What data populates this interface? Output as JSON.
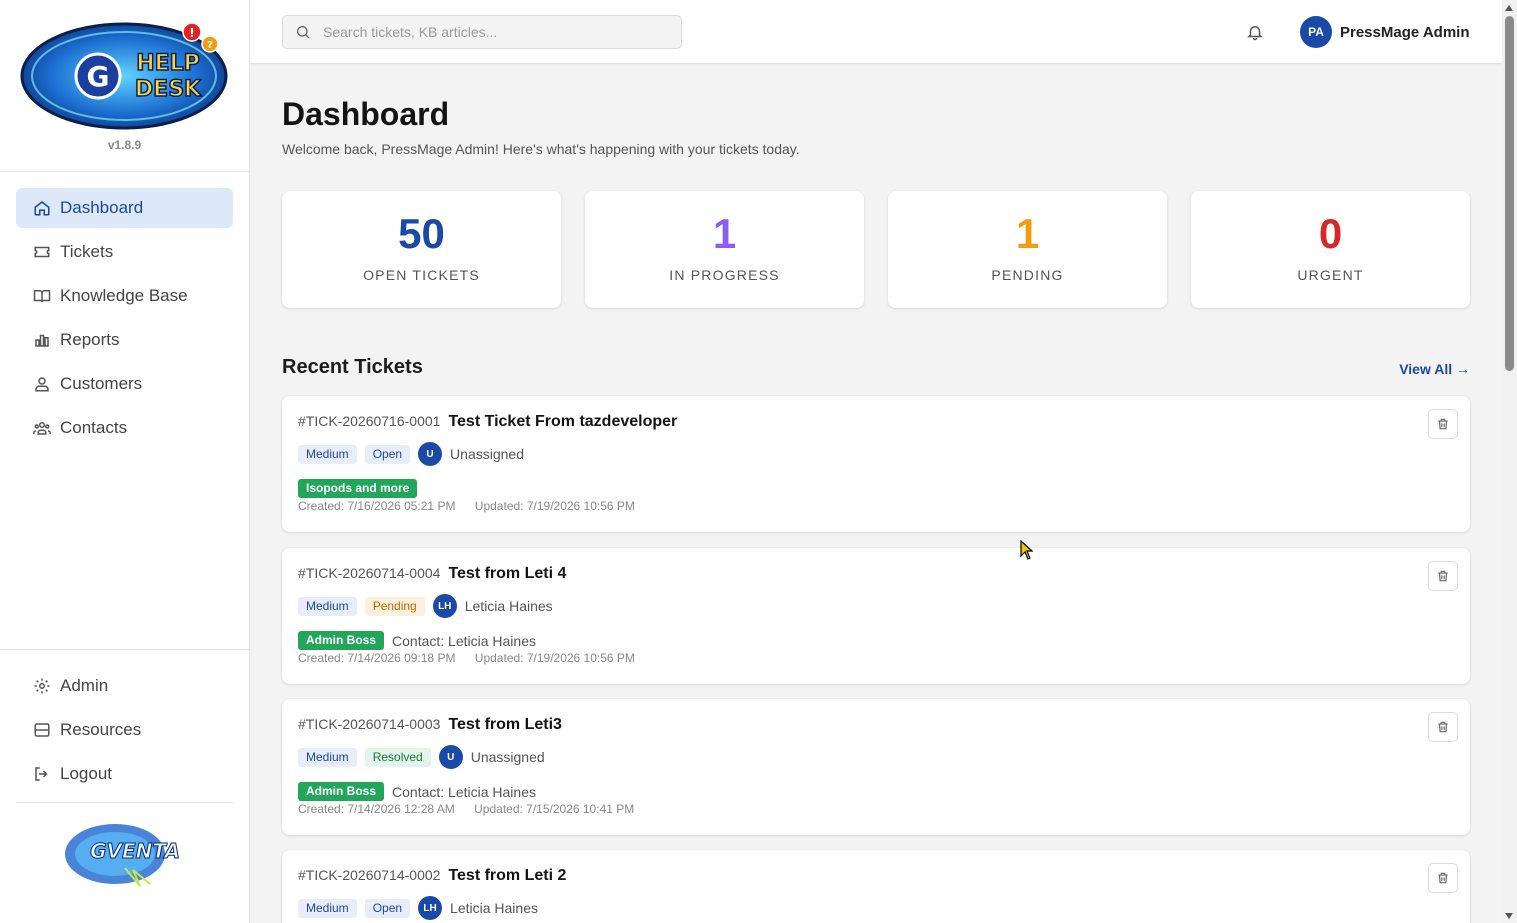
{
  "app": {
    "logo_alt": "HELP DESK",
    "version": "v1.8.9",
    "footer_logo": "GVENTA"
  },
  "sidebar": {
    "nav": [
      {
        "label": "Dashboard",
        "icon": "home-icon",
        "active": true
      },
      {
        "label": "Tickets",
        "icon": "ticket-icon"
      },
      {
        "label": "Knowledge Base",
        "icon": "book-icon"
      },
      {
        "label": "Reports",
        "icon": "bar-chart-icon"
      },
      {
        "label": "Customers",
        "icon": "users-icon"
      },
      {
        "label": "Contacts",
        "icon": "contacts-icon"
      }
    ],
    "bottom": [
      {
        "label": "Admin",
        "icon": "gear-icon"
      },
      {
        "label": "Resources",
        "icon": "server-icon"
      },
      {
        "label": "Logout",
        "icon": "logout-icon"
      }
    ]
  },
  "topbar": {
    "search_placeholder": "Search tickets, KB articles...",
    "user_initials": "PA",
    "user_name": "PressMage Admin"
  },
  "page": {
    "title": "Dashboard",
    "subtitle": "Welcome back, PressMage Admin! Here's what's happening with your tickets today."
  },
  "stats": [
    {
      "value": "50",
      "label": "OPEN TICKETS",
      "color": "#1b49a8"
    },
    {
      "value": "1",
      "label": "IN PROGRESS",
      "color": "#8b5cf6"
    },
    {
      "value": "1",
      "label": "PENDING",
      "color": "#f39c12"
    },
    {
      "value": "0",
      "label": "URGENT",
      "color": "#d62828"
    }
  ],
  "recent": {
    "title": "Recent Tickets",
    "view_all": "View All →",
    "tickets": [
      {
        "id": "#TICK-20260716-0001",
        "title": "Test Ticket From tazdeveloper",
        "priority": "Medium",
        "status": "Open",
        "assignee_initials": "U",
        "assignee": "Unassigned",
        "tag": "Isopods and more",
        "contact": "",
        "created": "Created: 7/16/2026 05:21 PM",
        "updated": "Updated: 7/19/2026 10:56 PM"
      },
      {
        "id": "#TICK-20260714-0004",
        "title": "Test from Leti 4",
        "priority": "Medium",
        "status": "Pending",
        "assignee_initials": "LH",
        "assignee": "Leticia Haines",
        "tag": "Admin Boss",
        "contact": "Contact: Leticia Haines",
        "created": "Created: 7/14/2026 09:18 PM",
        "updated": "Updated: 7/19/2026 10:56 PM"
      },
      {
        "id": "#TICK-20260714-0003",
        "title": "Test from Leti3",
        "priority": "Medium",
        "status": "Resolved",
        "assignee_initials": "U",
        "assignee": "Unassigned",
        "tag": "Admin Boss",
        "contact": "Contact: Leticia Haines",
        "created": "Created: 7/14/2026 12:28 AM",
        "updated": "Updated: 7/15/2026 10:41 PM"
      },
      {
        "id": "#TICK-20260714-0002",
        "title": "Test from Leti 2",
        "priority": "Medium",
        "status": "Open",
        "assignee_initials": "LH",
        "assignee": "Leticia Haines",
        "tag": "",
        "contact": "",
        "created": "",
        "updated": ""
      }
    ]
  }
}
